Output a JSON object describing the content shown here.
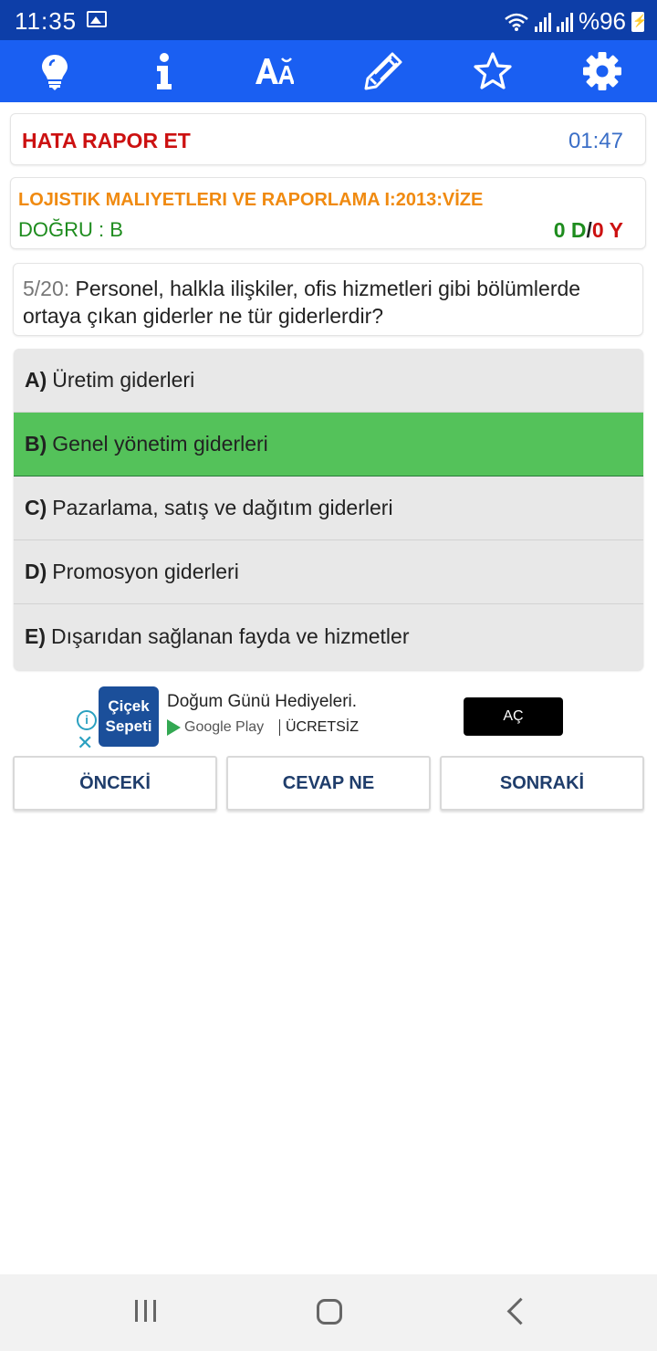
{
  "status_bar": {
    "time": "11:35",
    "battery": "%96"
  },
  "toolbar": {
    "icons": [
      "lightbulb-icon",
      "info-icon",
      "font-size-icon",
      "pencil-icon",
      "star-icon",
      "gear-icon"
    ]
  },
  "report": {
    "label": "HATA RAPOR ET",
    "timer": "01:47"
  },
  "info": {
    "course": "LOJISTIK MALIYETLERI VE RAPORLAMA I:2013:VİZE",
    "correct_answer": "DOĞRU : B",
    "score_correct": "0 D",
    "score_sep": "/",
    "score_wrong": "0 Y"
  },
  "question": {
    "number": "5/20:",
    "text": "Personel, halkla ilişkiler, ofis hizmetleri gibi bölümlerde ortaya çıkan giderler ne tür giderlerdir?"
  },
  "options": [
    {
      "letter": "A)",
      "text": "Üretim giderleri"
    },
    {
      "letter": "B)",
      "text": "Genel yönetim giderleri"
    },
    {
      "letter": "C)",
      "text": "Pazarlama, satış ve dağıtım giderleri"
    },
    {
      "letter": "D)",
      "text": "Promosyon giderleri"
    },
    {
      "letter": "E)",
      "text": "Dışarıdan sağlanan fayda ve hizmetler"
    }
  ],
  "selected_option": "B",
  "ad": {
    "logo_line1": "Çiçek",
    "logo_line2": "Sepeti",
    "title": "Doğum Günü Hediyeleri.",
    "store": "Google Play",
    "price": "ÜCRETSİZ",
    "cta": "AÇ"
  },
  "nav": {
    "prev": "ÖNCEKİ",
    "answer": "CEVAP NE",
    "next": "SONRAKİ"
  },
  "colors": {
    "status_bar": "#0d3ea8",
    "toolbar": "#1a5ff2",
    "report_label": "#cc1111",
    "timer": "#3a6ec7",
    "course": "#f08a10",
    "correct": "#1e8c1e",
    "selected_option": "#54c25a"
  }
}
